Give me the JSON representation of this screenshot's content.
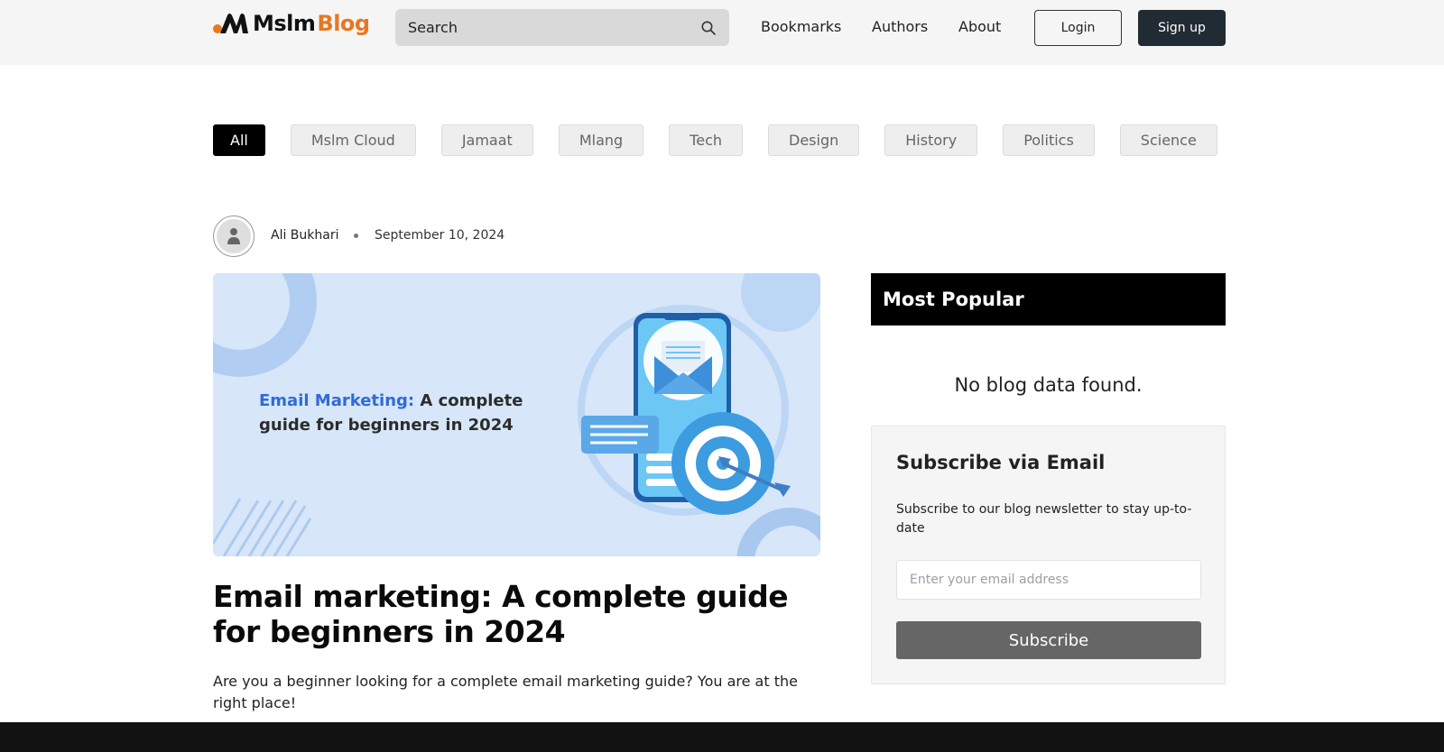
{
  "header": {
    "logo_text_primary": "Mslm",
    "logo_text_secondary": "Blog",
    "search_placeholder": "Search",
    "nav": [
      "Bookmarks",
      "Authors",
      "About"
    ],
    "login_label": "Login",
    "signup_label": "Sign up"
  },
  "categories": [
    "All",
    "Mslm Cloud",
    "Jamaat",
    "Mlang",
    "Tech",
    "Design",
    "History",
    "Politics",
    "Science"
  ],
  "active_category": "All",
  "post": {
    "author": "Ali Bukhari",
    "date": "September 10, 2024",
    "hero_highlight": "Email Marketing:",
    "hero_rest": " A complete guide for beginners in 2024",
    "title": "Email marketing: A complete guide for beginners in 2024",
    "excerpt": "Are you a beginner looking for a complete email marketing guide? You are at the right place!"
  },
  "sidebar": {
    "popular_title": "Most Popular",
    "no_data": "No blog data found.",
    "subscribe_title": "Subscribe via Email",
    "subscribe_desc": "Subscribe to our blog newsletter to stay up-to-date",
    "email_placeholder": "Enter your email address",
    "subscribe_button": "Subscribe"
  },
  "colors": {
    "brand_accent": "#e87722",
    "header_bg": "#f5f5f5",
    "signup_bg": "#212b33",
    "hero_bg": "#d7e6f8",
    "hero_highlight": "#2f6bd8",
    "footer_bg": "#121212"
  },
  "icons": {
    "logo": "mslm-logo-icon",
    "search": "search-icon",
    "avatar": "user-icon",
    "hero_illustration": "phone-email-target-illustration"
  }
}
